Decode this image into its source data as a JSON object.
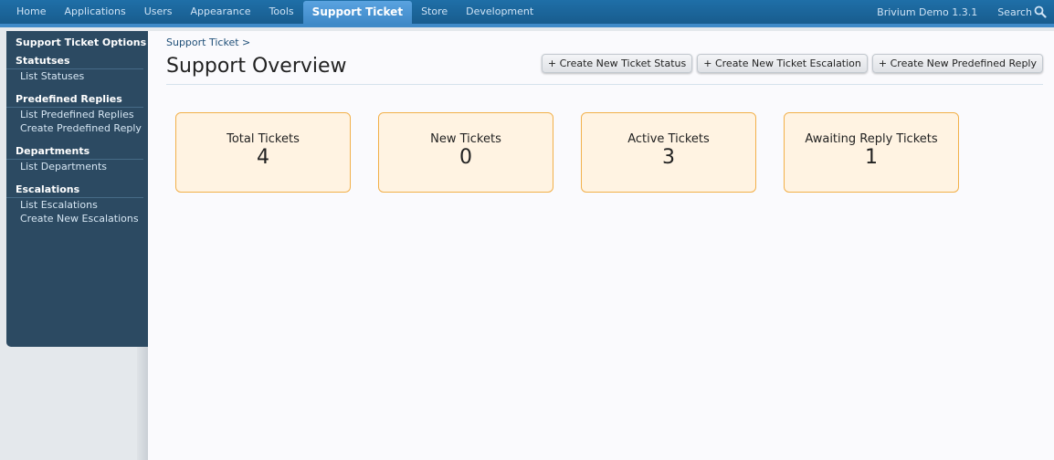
{
  "nav": {
    "tabs": [
      {
        "label": "Home"
      },
      {
        "label": "Applications"
      },
      {
        "label": "Users"
      },
      {
        "label": "Appearance"
      },
      {
        "label": "Tools"
      },
      {
        "label": "Support Ticket",
        "active": true
      },
      {
        "label": "Store"
      },
      {
        "label": "Development"
      }
    ],
    "site_name": "Brivium Demo 1.3.1",
    "search_label": "Search",
    "search_icon": "search-icon"
  },
  "sidebar": {
    "title": "Support Ticket Options",
    "sections": [
      {
        "heading": "Statutses",
        "links": [
          "List Statuses"
        ]
      },
      {
        "heading": "Predefined Replies",
        "links": [
          "List Predefined Replies",
          "Create Predefined Reply"
        ]
      },
      {
        "heading": "Departments",
        "links": [
          "List Departments"
        ]
      },
      {
        "heading": "Escalations",
        "links": [
          "List Escalations",
          "Create New Escalations"
        ]
      }
    ]
  },
  "main": {
    "breadcrumb": "Support Ticket >",
    "title": "Support Overview",
    "actions": [
      "+ Create New Ticket Status",
      "+ Create New Ticket Escalation",
      "+ Create New Predefined Reply"
    ],
    "stats": [
      {
        "label": "Total Tickets",
        "value": "4"
      },
      {
        "label": "New Tickets",
        "value": "0"
      },
      {
        "label": "Active Tickets",
        "value": "3"
      },
      {
        "label": "Awaiting Reply Tickets",
        "value": "1"
      }
    ]
  },
  "colors": {
    "nav_bg": "#1f6fa8",
    "active_tab": "#3f8ac8",
    "sidebar_bg": "#2c4a62",
    "card_bg": "#fff3e2",
    "card_border": "#f2b04a"
  }
}
